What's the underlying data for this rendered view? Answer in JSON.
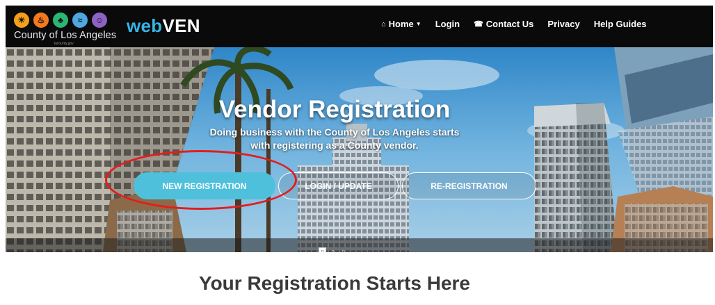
{
  "navbar": {
    "county_name": "County of Los Angeles",
    "county_url": "lacounty.gov",
    "product_part1": "web",
    "product_part2": "VEN",
    "links": [
      {
        "label": "Home",
        "icon": "home-icon"
      },
      {
        "label": "Login"
      },
      {
        "label": "Contact Us",
        "icon": "phone-icon"
      },
      {
        "label": "Privacy"
      },
      {
        "label": "Help Guides"
      }
    ]
  },
  "hero": {
    "title": "Vendor Registration",
    "subtitle_line1": "Doing business with the County of Los Angeles starts",
    "subtitle_line2": "with registering as a County vendor.",
    "buttons": {
      "new_registration": "NEW REGISTRATION",
      "login_update": "LOGIN / UPDATE",
      "re_registration": "RE-REGISTRATION"
    },
    "carousel_count": 3,
    "carousel_active": 1
  },
  "section": {
    "heading": "Your Registration Starts Here"
  },
  "colors": {
    "navbar_bg": "#0a0a0a",
    "brand_accent": "#35b5e5",
    "primary_button": "#4fc0dc",
    "annotation": "#e41c1c",
    "heading_text": "#3a3a3a"
  }
}
